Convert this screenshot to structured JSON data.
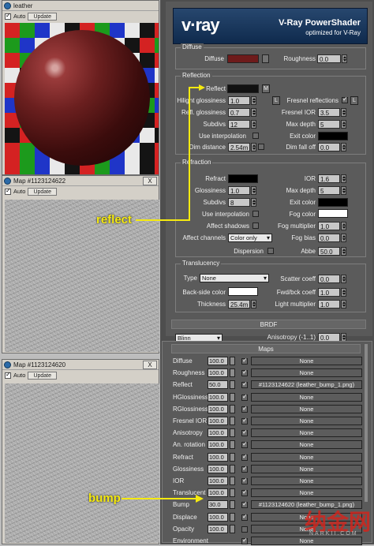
{
  "win1": {
    "title": "leather",
    "auto": "Auto",
    "update": "Update"
  },
  "win2": {
    "title": "Map #1123124622",
    "close": "X",
    "auto": "Auto",
    "update": "Update"
  },
  "win3": {
    "title": "Map #1123124620",
    "close": "X",
    "auto": "Auto",
    "update": "Update"
  },
  "banner": {
    "logo": "v·ray",
    "title": "V-Ray PowerShader",
    "subtitle": "optimized for V-Ray"
  },
  "diffuse": {
    "group": "Diffuse",
    "diffuse": "Diffuse",
    "roughness": "Roughness",
    "roughness_val": "0.0",
    "diffuse_color": "#6e1b1b"
  },
  "reflection": {
    "group": "Reflection",
    "reflect": "Reflect",
    "m": "M",
    "l": "L",
    "hilight": "Hilight glossiness",
    "hilight_val": "1.0",
    "refl_gloss": "Refl. glossiness",
    "refl_gloss_val": "0.7",
    "subdivs": "Subdivs",
    "subdivs_val": "12",
    "use_interp": "Use interpolation",
    "dim_distance": "Dim distance",
    "dim_distance_val": "2.54m",
    "fresnel": "Fresnel reflections",
    "fresnel_ior": "Fresnel IOR",
    "fresnel_ior_val": "3.5",
    "max_depth": "Max depth",
    "max_depth_val": "5",
    "exit_color": "Exit color",
    "dim_fall_off": "Dim fall off",
    "dim_fall_off_val": "0.0"
  },
  "refraction": {
    "group": "Refraction",
    "refract": "Refract",
    "ior": "IOR",
    "ior_val": "1.6",
    "glossiness": "Glossiness",
    "glossiness_val": "1.0",
    "max_depth": "Max depth",
    "max_depth_val": "5",
    "subdivs": "Subdivs",
    "subdivs_val": "8",
    "exit_color": "Exit color",
    "use_interp": "Use interpolation",
    "fog_color": "Fog color",
    "affect_shadows": "Affect shadows",
    "fog_mult": "Fog multiplier",
    "fog_mult_val": "1.0",
    "affect_channels": "Affect channels",
    "affect_channels_val": "Color only",
    "fog_bias": "Fog bias",
    "fog_bias_val": "0.0",
    "dispersion": "Dispersion",
    "abbe": "Abbe",
    "abbe_val": "50.0"
  },
  "translucency": {
    "group": "Translucency",
    "type": "Type",
    "type_val": "None",
    "scatter": "Scatter coeff",
    "scatter_val": "0.0",
    "backside": "Back-side color",
    "fwdbck": "Fwd/bck coeff",
    "fwdbck_val": "1.0",
    "thickness": "Thickness",
    "thickness_val": "25.4m",
    "light_mult": "Light multiplier",
    "light_mult_val": "1.0"
  },
  "brdf": {
    "title": "BRDF",
    "type_val": "Blinn",
    "aniso": "Anisotropy (-1..1)",
    "aniso_val": "0.0"
  },
  "maps": {
    "title": "Maps",
    "rows": [
      {
        "name": "Diffuse",
        "val": "100.0",
        "on": true,
        "slot": "None"
      },
      {
        "name": "Roughness",
        "val": "100.0",
        "on": true,
        "slot": "None"
      },
      {
        "name": "Reflect",
        "val": "50.0",
        "on": true,
        "slot": "#1123124622 (leather_bump_1.png)"
      },
      {
        "name": "HGlossiness",
        "val": "100.0",
        "on": true,
        "slot": "None"
      },
      {
        "name": "RGlossiness",
        "val": "100.0",
        "on": true,
        "slot": "None"
      },
      {
        "name": "Fresnel IOR",
        "val": "100.0",
        "on": true,
        "slot": "None"
      },
      {
        "name": "Anisotropy",
        "val": "100.0",
        "on": true,
        "slot": "None"
      },
      {
        "name": "An. rotation",
        "val": "100.0",
        "on": true,
        "slot": "None"
      },
      {
        "name": "Refract",
        "val": "100.0",
        "on": true,
        "slot": "None"
      },
      {
        "name": "Glossiness",
        "val": "100.0",
        "on": true,
        "slot": "None"
      },
      {
        "name": "IOR",
        "val": "100.0",
        "on": true,
        "slot": "None"
      },
      {
        "name": "Translucent",
        "val": "100.0",
        "on": true,
        "slot": "None"
      },
      {
        "name": "Bump",
        "val": "30.0",
        "on": true,
        "slot": "#1123124620 (leather_bump_1.png)"
      },
      {
        "name": "Displace",
        "val": "100.0",
        "on": true,
        "slot": "None"
      },
      {
        "name": "Opacity",
        "val": "100.0",
        "on": false,
        "slot": "None"
      },
      {
        "name": "Environment",
        "val": "",
        "on": true,
        "slot": "None"
      }
    ]
  },
  "annotations": {
    "reflect": "reflect",
    "bump": "bump"
  },
  "watermark": {
    "text": "纳金网",
    "sub": "NARKII.COM"
  },
  "colors": {
    "accent": "#f5ea10",
    "diffuse": "#6e1b1b"
  }
}
